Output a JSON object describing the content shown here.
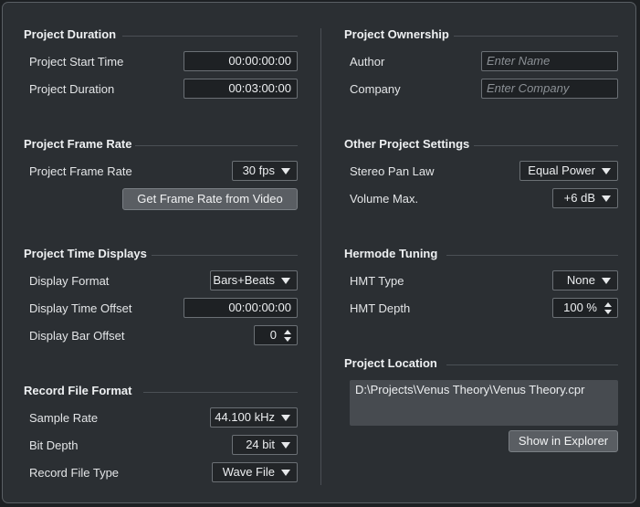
{
  "project_duration": {
    "title": "Project Duration",
    "start_time_label": "Project Start Time",
    "start_time_value": "00:00:00:00",
    "duration_label": "Project Duration",
    "duration_value": "00:03:00:00"
  },
  "project_frame_rate": {
    "title": "Project Frame Rate",
    "frame_rate_label": "Project Frame Rate",
    "frame_rate_value": "30 fps",
    "get_from_video_label": "Get Frame Rate from Video"
  },
  "project_time_displays": {
    "title": "Project Time Displays",
    "display_format_label": "Display Format",
    "display_format_value": "Bars+Beats",
    "time_offset_label": "Display Time Offset",
    "time_offset_value": "00:00:00:00",
    "bar_offset_label": "Display Bar Offset",
    "bar_offset_value": "0"
  },
  "record_file_format": {
    "title": "Record File Format",
    "sample_rate_label": "Sample Rate",
    "sample_rate_value": "44.100 kHz",
    "bit_depth_label": "Bit Depth",
    "bit_depth_value": "24 bit",
    "file_type_label": "Record File Type",
    "file_type_value": "Wave File"
  },
  "project_ownership": {
    "title": "Project Ownership",
    "author_label": "Author",
    "author_placeholder": "Enter Name",
    "company_label": "Company",
    "company_placeholder": "Enter Company"
  },
  "other_settings": {
    "title": "Other Project Settings",
    "pan_law_label": "Stereo Pan Law",
    "pan_law_value": "Equal Power",
    "volume_max_label": "Volume Max.",
    "volume_max_value": "+6 dB"
  },
  "hermode_tuning": {
    "title": "Hermode Tuning",
    "hmt_type_label": "HMT Type",
    "hmt_type_value": "None",
    "hmt_depth_label": "HMT Depth",
    "hmt_depth_value": "100 %"
  },
  "project_location": {
    "title": "Project Location",
    "path": "D:\\Projects\\Venus Theory\\Venus Theory.cpr",
    "show_in_explorer_label": "Show in Explorer"
  }
}
